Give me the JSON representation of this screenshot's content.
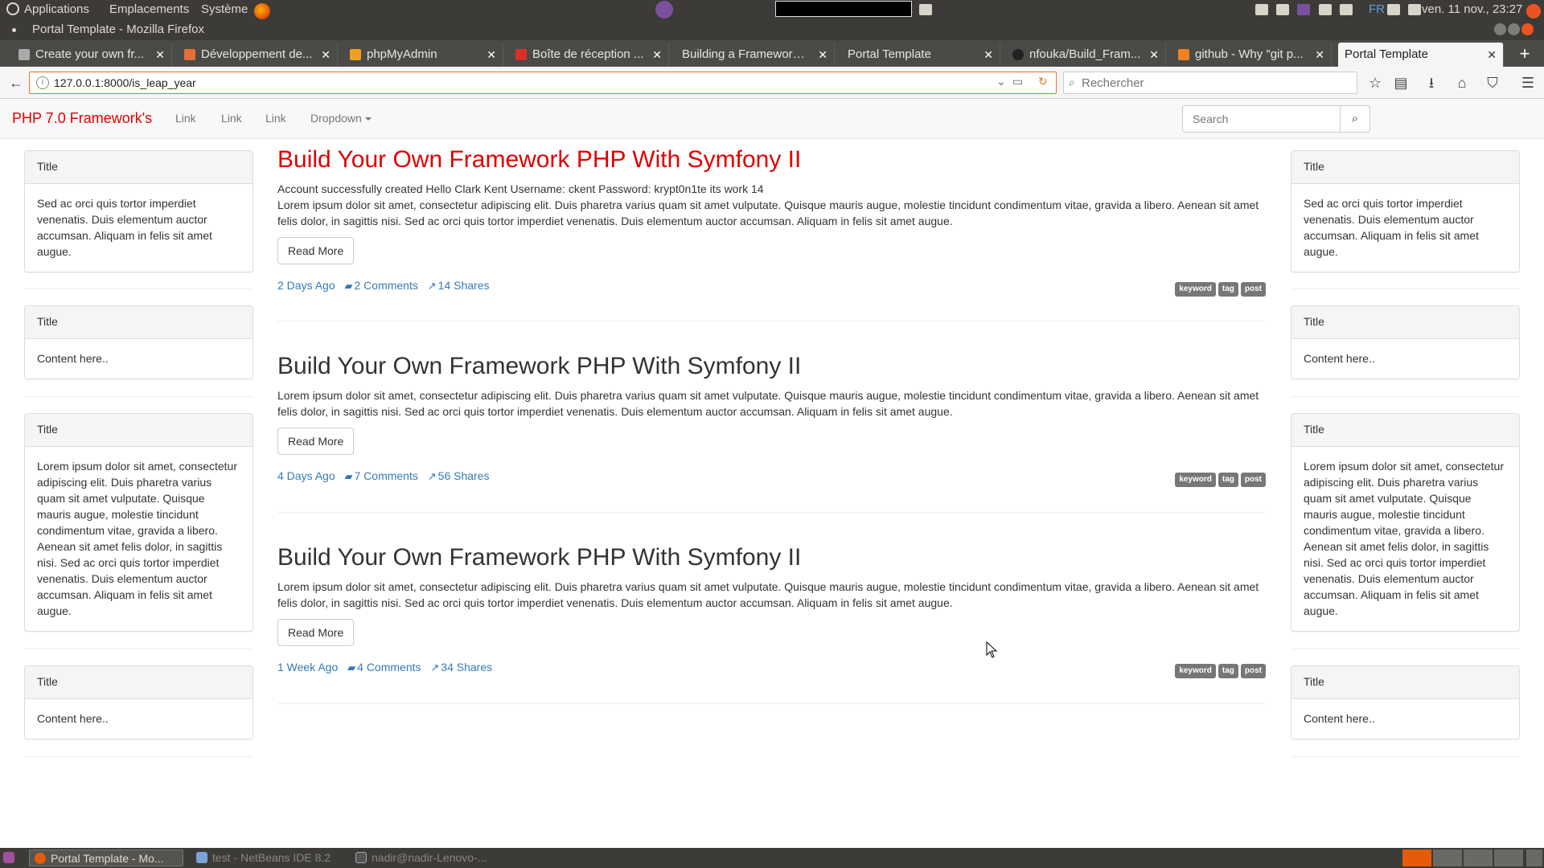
{
  "os_panel": {
    "menus": [
      "Applications",
      "Emplacements",
      "Système"
    ],
    "keyboard_layout": "FR",
    "clock": "ven. 11 nov., 23:27"
  },
  "window": {
    "title": "Portal Template - Mozilla Firefox"
  },
  "tabs": [
    {
      "label": "Create your own fr...",
      "icon": "page-icon"
    },
    {
      "label": "Développement de...",
      "icon": "page-icon"
    },
    {
      "label": "phpMyAdmin",
      "icon": "phpmyadmin-icon"
    },
    {
      "label": "Boîte de réception ...",
      "icon": "gmail-icon"
    },
    {
      "label": "Building a Framework ...",
      "icon": "none"
    },
    {
      "label": "Portal Template",
      "icon": "none"
    },
    {
      "label": "nfouka/Build_Fram...",
      "icon": "github-icon"
    },
    {
      "label": "github - Why \"git p...",
      "icon": "stackoverflow-icon"
    },
    {
      "label": "Portal Template",
      "icon": "none",
      "active": true
    }
  ],
  "navbar": {
    "url": "127.0.0.1:8000/is_leap_year",
    "search_placeholder": "Rechercher"
  },
  "site": {
    "brand": "PHP 7.0 Framework's",
    "links": [
      "Link",
      "Link",
      "Link"
    ],
    "dropdown": "Dropdown",
    "search_placeholder": "Search",
    "brand_color": "#e00000",
    "link_color": "#337ab7"
  },
  "sidebar_left": [
    {
      "title": "Title",
      "body": "Sed ac orci quis tortor imperdiet venenatis. Duis elementum auctor accumsan. Aliquam in felis sit amet augue."
    },
    {
      "title": "Title",
      "body": "Content here.."
    },
    {
      "title": "Title",
      "body": "Lorem ipsum dolor sit amet, consectetur adipiscing elit. Duis pharetra varius quam sit amet vulputate. Quisque mauris augue, molestie tincidunt condimentum vitae, gravida a libero. Aenean sit amet felis dolor, in sagittis nisi. Sed ac orci quis tortor imperdiet venenatis. Duis elementum auctor accumsan. Aliquam in felis sit amet augue."
    },
    {
      "title": "Title",
      "body": "Content here.."
    }
  ],
  "sidebar_right": [
    {
      "title": "Title",
      "body": "Sed ac orci quis tortor imperdiet venenatis. Duis elementum auctor accumsan. Aliquam in felis sit amet augue."
    },
    {
      "title": "Title",
      "body": "Content here.."
    },
    {
      "title": "Title",
      "body": "Lorem ipsum dolor sit amet, consectetur adipiscing elit. Duis pharetra varius quam sit amet vulputate. Quisque mauris augue, molestie tincidunt condimentum vitae, gravida a libero. Aenean sit amet felis dolor, in sagittis nisi. Sed ac orci quis tortor imperdiet venenatis. Duis elementum auctor accumsan. Aliquam in felis sit amet augue."
    },
    {
      "title": "Title",
      "body": "Content here.."
    }
  ],
  "posts": [
    {
      "title": "Build Your Own Framework PHP With Symfony II",
      "message": "Account successfully created Hello Clark Kent Username: ckent Password: krypt0n1te its work 14",
      "body": "Lorem ipsum dolor sit amet, consectetur adipiscing elit. Duis pharetra varius quam sit amet vulputate. Quisque mauris augue, molestie tincidunt condimentum vitae, gravida a libero. Aenean sit amet felis dolor, in sagittis nisi. Sed ac orci quis tortor imperdiet venenatis. Duis elementum auctor accumsan. Aliquam in felis sit amet augue.",
      "read_more": "Read More",
      "date": "2 Days Ago",
      "comments": "2 Comments",
      "shares": "14 Shares",
      "tags": [
        "keyword",
        "tag",
        "post"
      ]
    },
    {
      "title": "Build Your Own Framework PHP With Symfony II",
      "message": "",
      "body": "Lorem ipsum dolor sit amet, consectetur adipiscing elit. Duis pharetra varius quam sit amet vulputate. Quisque mauris augue, molestie tincidunt condimentum vitae, gravida a libero. Aenean sit amet felis dolor, in sagittis nisi. Sed ac orci quis tortor imperdiet venenatis. Duis elementum auctor accumsan. Aliquam in felis sit amet augue.",
      "read_more": "Read More",
      "date": "4 Days Ago",
      "comments": "7 Comments",
      "shares": "56 Shares",
      "tags": [
        "keyword",
        "tag",
        "post"
      ]
    },
    {
      "title": "Build Your Own Framework PHP With Symfony II",
      "message": "",
      "body": "Lorem ipsum dolor sit amet, consectetur adipiscing elit. Duis pharetra varius quam sit amet vulputate. Quisque mauris augue, molestie tincidunt condimentum vitae, gravida a libero. Aenean sit amet felis dolor, in sagittis nisi. Sed ac orci quis tortor imperdiet venenatis. Duis elementum auctor accumsan. Aliquam in felis sit amet augue.",
      "read_more": "Read More",
      "date": "1 Week Ago",
      "comments": "4 Comments",
      "shares": "34 Shares",
      "tags": [
        "keyword",
        "tag",
        "post"
      ]
    }
  ],
  "taskbar": {
    "items": [
      "Portal Template - Mo...",
      "test - NetBeans IDE 8.2",
      "nadir@nadir-Lenovo-..."
    ]
  }
}
